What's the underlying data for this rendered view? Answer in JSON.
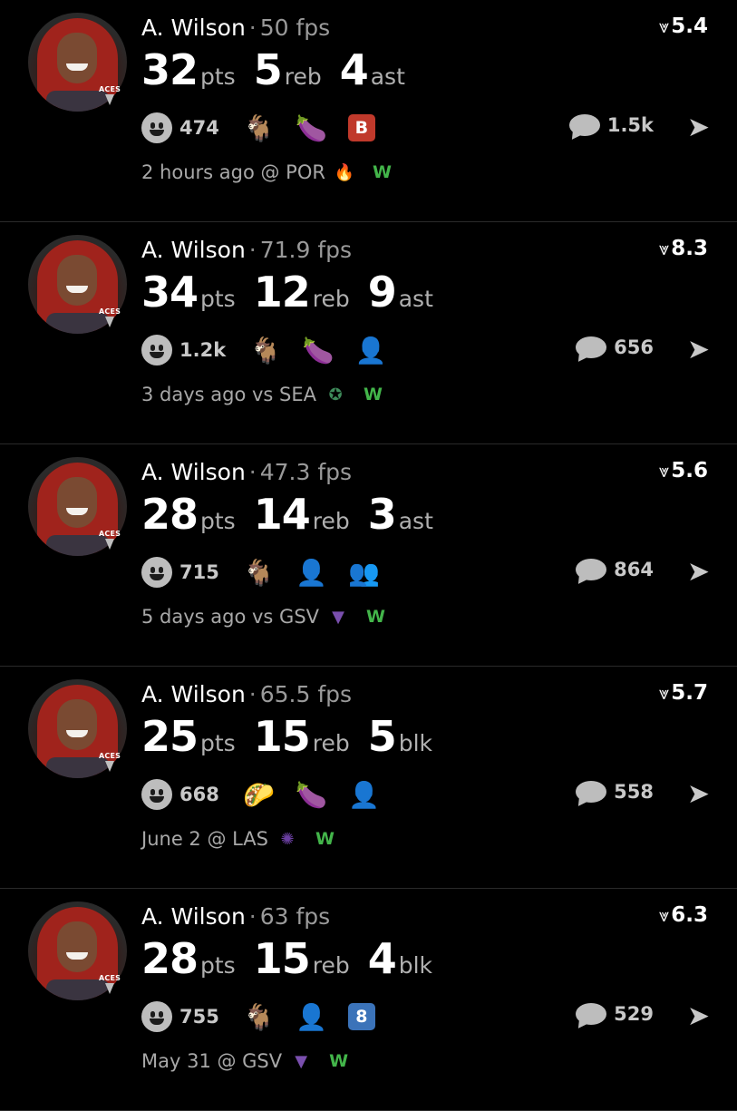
{
  "posts": [
    {
      "name": "A. Wilson",
      "sep": "·",
      "fps": "50 fps",
      "score": "5.4",
      "score_icon": "⩔",
      "stats": [
        {
          "n": "32",
          "u": "pts"
        },
        {
          "n": "5",
          "u": "reb"
        },
        {
          "n": "4",
          "u": "ast"
        }
      ],
      "reactions": "474",
      "comments": "1.5k",
      "emojis": [
        {
          "icon": "goat",
          "glyph": "🐐"
        },
        {
          "icon": "eggplant",
          "glyph": "🍆"
        },
        {
          "icon": "b-square",
          "glyph": "B",
          "color": "#c0392b"
        }
      ],
      "time": "2 hours ago @ POR",
      "team_icon": "fire-logo",
      "team_glyph": "🔥",
      "result": "W"
    },
    {
      "name": "A. Wilson",
      "sep": "·",
      "fps": "71.9 fps",
      "score": "8.3",
      "score_icon": "⩔",
      "stats": [
        {
          "n": "34",
          "u": "pts"
        },
        {
          "n": "12",
          "u": "reb"
        },
        {
          "n": "9",
          "u": "ast"
        }
      ],
      "reactions": "1.2k",
      "comments": "656",
      "emojis": [
        {
          "icon": "goat",
          "glyph": "🐐"
        },
        {
          "icon": "eggplant",
          "glyph": "🍆"
        },
        {
          "icon": "face",
          "glyph": "👤"
        }
      ],
      "time": "3 days ago vs SEA",
      "team_icon": "storm-logo",
      "team_glyph": "✪",
      "result": "W"
    },
    {
      "name": "A. Wilson",
      "sep": "·",
      "fps": "47.3 fps",
      "score": "5.6",
      "score_icon": "⩔",
      "stats": [
        {
          "n": "28",
          "u": "pts"
        },
        {
          "n": "14",
          "u": "reb"
        },
        {
          "n": "3",
          "u": "ast"
        }
      ],
      "reactions": "715",
      "comments": "864",
      "emojis": [
        {
          "icon": "goat",
          "glyph": "🐐"
        },
        {
          "icon": "face",
          "glyph": "👤"
        },
        {
          "icon": "people",
          "glyph": "👥"
        }
      ],
      "time": "5 days ago vs GSV",
      "team_icon": "valkyries-logo",
      "team_glyph": "▼",
      "result": "W"
    },
    {
      "name": "A. Wilson",
      "sep": "·",
      "fps": "65.5 fps",
      "score": "5.7",
      "score_icon": "⩔",
      "stats": [
        {
          "n": "25",
          "u": "pts"
        },
        {
          "n": "15",
          "u": "reb"
        },
        {
          "n": "5",
          "u": "blk"
        }
      ],
      "reactions": "668",
      "comments": "558",
      "emojis": [
        {
          "icon": "taco",
          "glyph": "🌮"
        },
        {
          "icon": "eggplant",
          "glyph": "🍆"
        },
        {
          "icon": "face",
          "glyph": "👤"
        }
      ],
      "time": "June 2 @ LAS",
      "team_icon": "sparks-logo",
      "team_glyph": "✺",
      "result": "W"
    },
    {
      "name": "A. Wilson",
      "sep": "·",
      "fps": "63 fps",
      "score": "6.3",
      "score_icon": "⩔",
      "stats": [
        {
          "n": "28",
          "u": "pts"
        },
        {
          "n": "15",
          "u": "reb"
        },
        {
          "n": "4",
          "u": "blk"
        }
      ],
      "reactions": "755",
      "comments": "529",
      "emojis": [
        {
          "icon": "goat",
          "glyph": "🐐"
        },
        {
          "icon": "face",
          "glyph": "👤"
        },
        {
          "icon": "eight-square",
          "glyph": "8",
          "color": "#3b73b9"
        }
      ],
      "time": "May 31 @ GSV",
      "team_icon": "valkyries-logo",
      "team_glyph": "▼",
      "result": "W"
    }
  ],
  "badge_text": "ACES",
  "colors": {
    "background": "#000000",
    "win": "#43b54a",
    "muted": "#9a9a9a"
  }
}
